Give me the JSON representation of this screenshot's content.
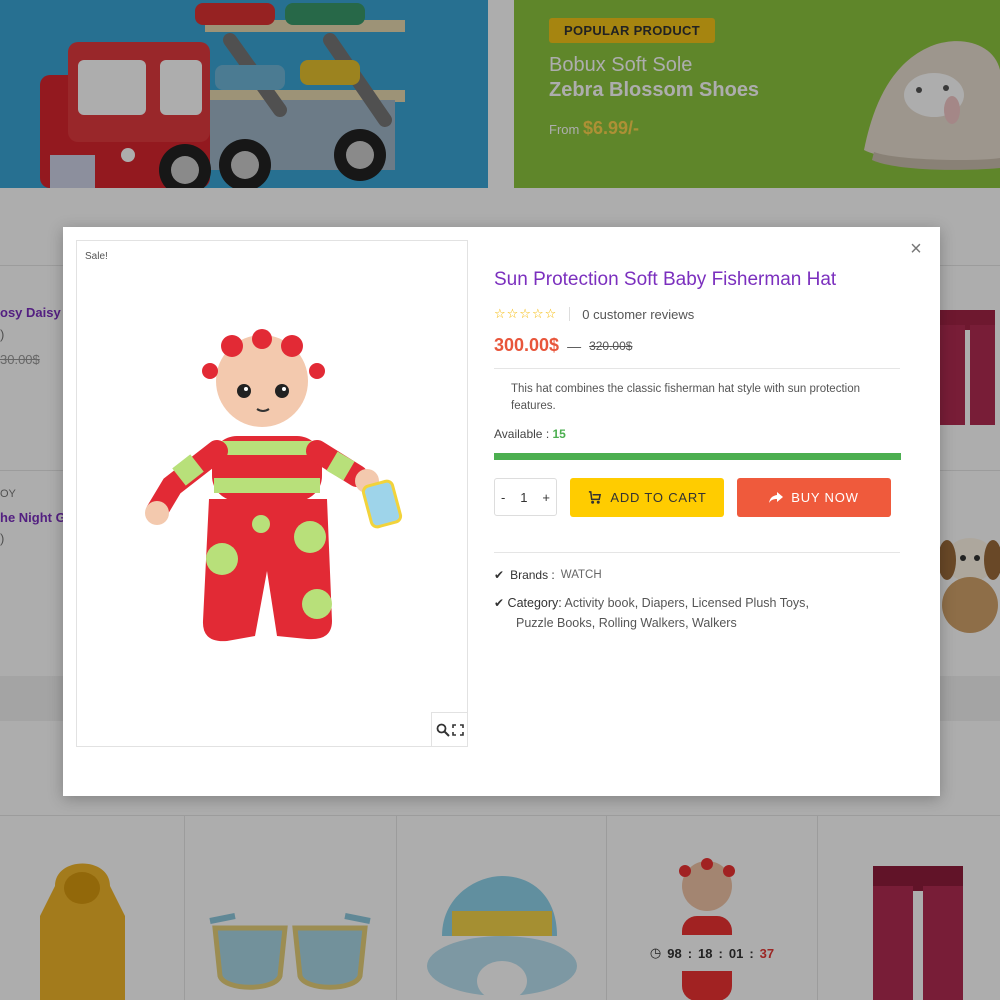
{
  "banner": {
    "badge": "POPULAR PRODUCT",
    "subtitle": "Bobux Soft Sole",
    "title": "Zebra Blossom Shoes",
    "price_prefix": "From",
    "price": "$6.99/-"
  },
  "background_list": {
    "item1_name": "osy Daisy T",
    "item1_extra": ")",
    "item1_old_price": "30.00$",
    "item2_category": "OY",
    "item2_name": "he Night G",
    "item2_extra": ")"
  },
  "timer": {
    "days": "98",
    "hours": "18",
    "minutes": "01",
    "seconds": "37",
    "sep": ":"
  },
  "modal": {
    "sale_label": "Sale!",
    "title": "Sun Protection Soft Baby Fisherman Hat",
    "stars": "☆☆☆☆☆",
    "reviews": "0 customer reviews",
    "price_current": "300.00$",
    "price_dash": "—",
    "price_old": "320.00$",
    "description": "This hat combines the classic fisherman hat style with sun protection features.",
    "available_label": "Available :",
    "available_count": "15",
    "stock_fraction": 1.0,
    "qty_minus": "-",
    "qty_value": "1",
    "qty_plus": "+",
    "add_to_cart": "ADD TO CART",
    "buy_now": "BUY NOW",
    "brands_label": "Brands :",
    "brands_value": "WATCH",
    "category_label": "Category:",
    "categories": [
      "Activity book",
      "Diapers",
      "Licensed Plush Toys",
      "Puzzle Books",
      "Rolling Walkers",
      "Walkers"
    ],
    "close": "×"
  },
  "colors": {
    "title_purple": "#7b2fbe",
    "price_red": "#e8563b",
    "cart_yellow": "#ffcc00",
    "buy_orange": "#ef5a3c",
    "stock_green": "#4caf50"
  }
}
